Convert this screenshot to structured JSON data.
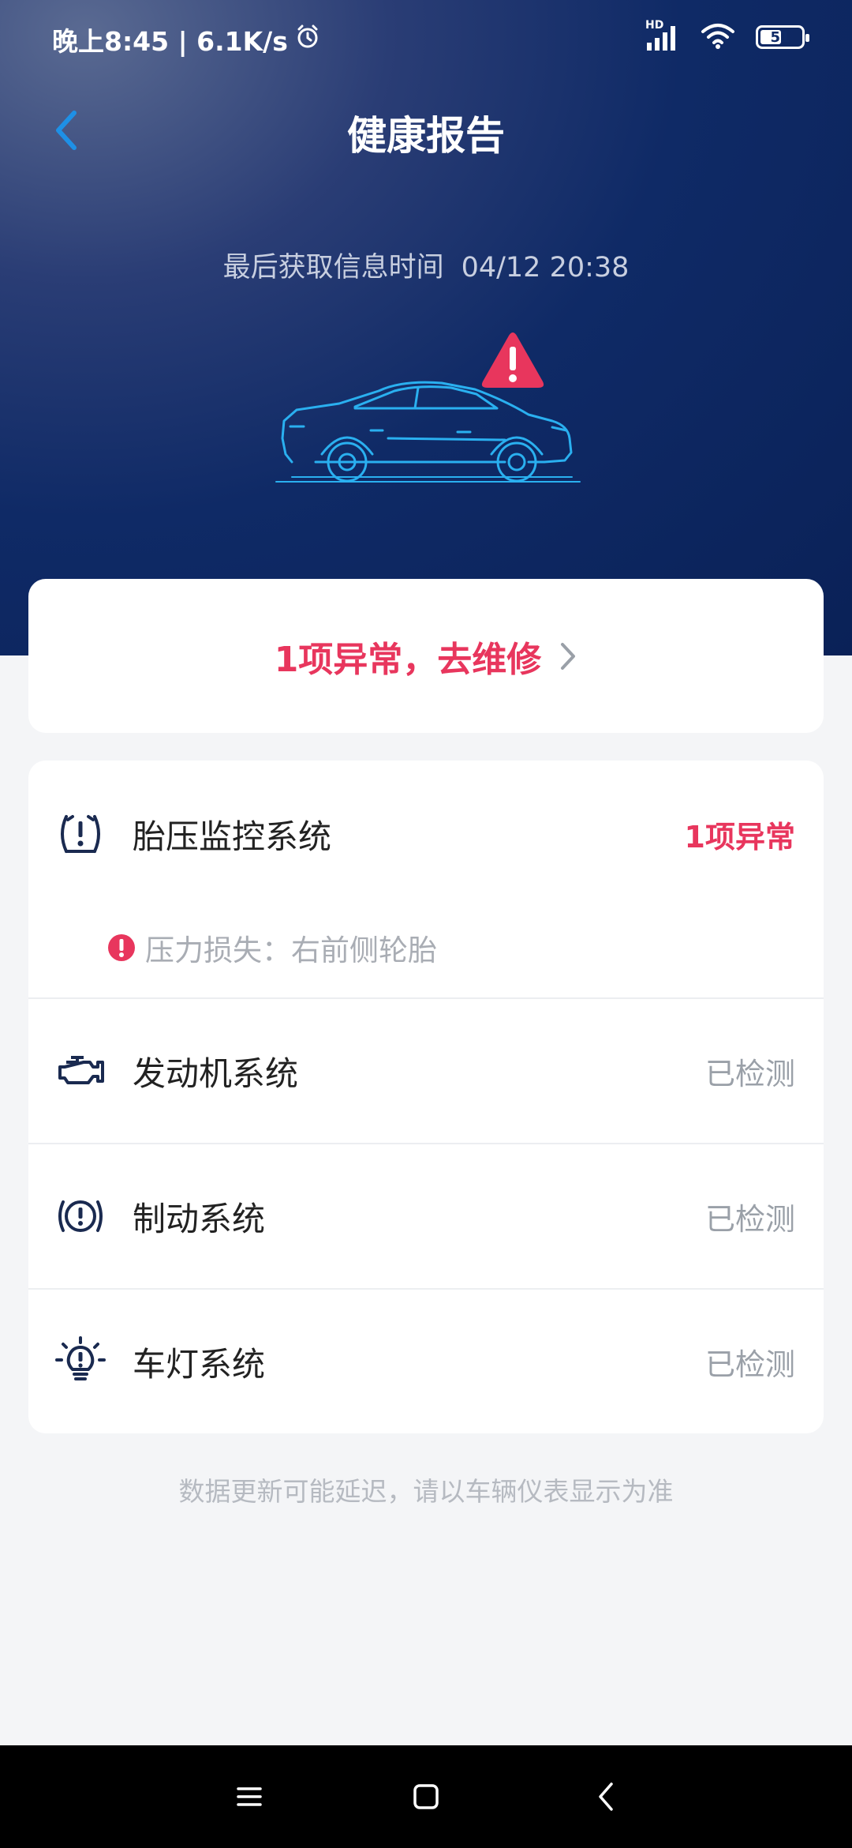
{
  "status_bar": {
    "time_speed": "晚上8:45 | 6.1K/s",
    "battery_level": "51",
    "battery_fraction": 0.51,
    "network_label": "HD",
    "alarm_icon": "alarm-clock-icon",
    "signal_icon": "cellular-signal-icon",
    "wifi_icon": "wifi-icon"
  },
  "header": {
    "title": "健康报告",
    "back_icon": "chevron-left-icon",
    "last_update_label": "最后获取信息时间",
    "last_update_time": "04/12 20:38",
    "warning_icon": "warning-triangle-icon"
  },
  "repair_banner": {
    "text": "1项异常，去维修",
    "chevron_icon": "chevron-right-icon"
  },
  "systems": [
    {
      "name": "胎压监控系统",
      "status": "1项异常",
      "icon": "tire-pressure-icon",
      "alert": {
        "icon": "alert-circle-icon",
        "text": "压力损失：右前侧轮胎"
      }
    },
    {
      "name": "发动机系统",
      "status": "已检测",
      "icon": "engine-icon"
    },
    {
      "name": "制动系统",
      "status": "已检测",
      "icon": "brake-warning-icon"
    },
    {
      "name": "车灯系统",
      "status": "已检测",
      "icon": "light-bulb-icon"
    }
  ],
  "footnote": "数据更新可能延迟，请以车辆仪表显示为准",
  "nav_bar": {
    "menu_icon": "menu-icon",
    "home_icon": "home-square-icon",
    "back_icon": "back-triangle-icon"
  },
  "colors": {
    "header_bg": "#0f2a66",
    "alert": "#e8365d",
    "accent_blue": "#1e90e6",
    "page_bg": "#f4f5f7"
  }
}
